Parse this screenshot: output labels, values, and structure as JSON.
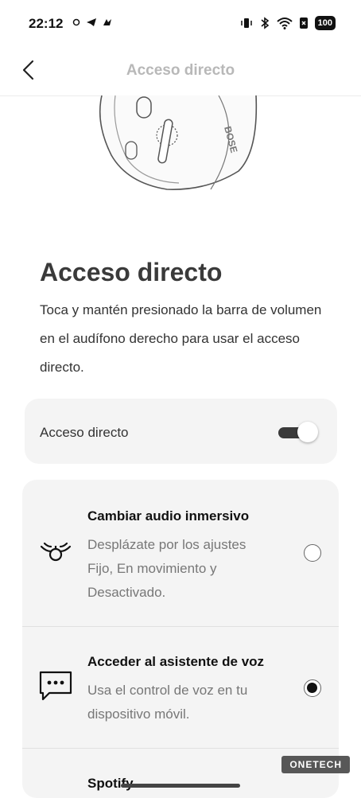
{
  "status": {
    "time": "22:12",
    "battery": "100",
    "left_icons": [
      "dot-ring-icon",
      "telegram-icon",
      "app-icon"
    ],
    "right_icons": [
      "vibrate-icon",
      "bluetooth-icon",
      "wifi-icon",
      "sim-icon"
    ]
  },
  "header": {
    "title": "Acceso directo",
    "back_icon": "chevron-left-icon"
  },
  "main": {
    "heading": "Acceso directo",
    "description": "Toca y mantén presionado la barra de volumen en el audífono derecho para usar el acceso directo."
  },
  "shortcut_toggle": {
    "label": "Acceso directo",
    "enabled": true
  },
  "options": [
    {
      "title": "Cambiar audio inmersivo",
      "description": "Desplázate por los ajustes Fijo, En movimiento y Desactivado.",
      "icon": "immersive-audio-icon",
      "selected": false
    },
    {
      "title": "Acceder al asistente de voz",
      "description": "Usa el control de voz en tu dispositivo móvil.",
      "icon": "chat-bubble-icon",
      "selected": true
    },
    {
      "title": "Spotify",
      "description": "",
      "icon": "spotify-icon",
      "selected": false
    }
  ],
  "watermark": "ONETECH",
  "colors": {
    "background": "#ffffff",
    "card": "#f4f4f4",
    "toggle_on": "#3a3a3a",
    "title_muted": "#b8b8b8"
  }
}
